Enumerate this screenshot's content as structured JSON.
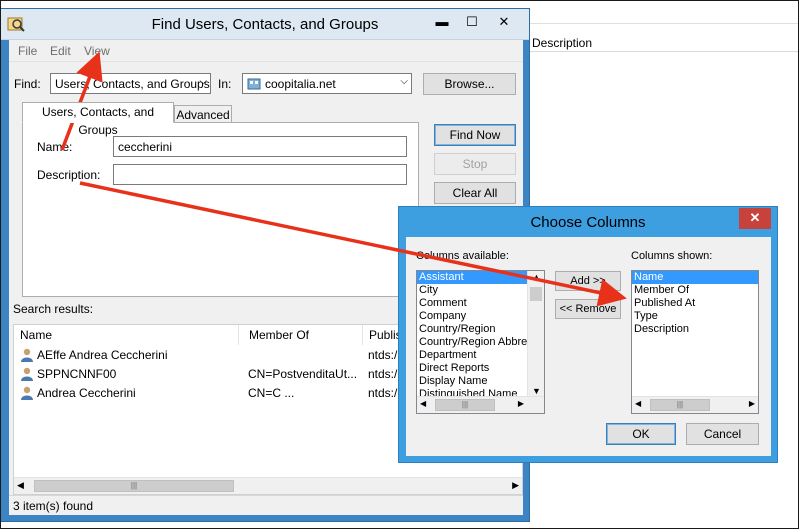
{
  "background": {
    "column_header": "Description"
  },
  "find_window": {
    "title": "Find Users, Contacts, and Groups",
    "minimize": "▬",
    "maximize": "☐",
    "close": "✕",
    "menu": [
      "File",
      "Edit",
      "View"
    ],
    "find_label": "Find:",
    "find_value": "Users, Contacts, and Groups",
    "in_label": "In:",
    "in_value": "coopitalia.net",
    "browse_button": "Browse...",
    "tabs": [
      "Users, Contacts, and Groups",
      "Advanced"
    ],
    "name_label": "Name:",
    "name_value": "ceccherini",
    "description_label": "Description:",
    "description_value": "",
    "find_now_button": "Find Now",
    "stop_button": "Stop",
    "clear_all_button": "Clear All",
    "search_results_label": "Search results:",
    "columns": [
      "Name",
      "Member Of",
      "Publis"
    ],
    "rows": [
      {
        "name": "AEffe Andrea Ceccherini",
        "member_of": "",
        "published": "ntds:/"
      },
      {
        "name": "SPPNCNNF00",
        "member_of": "CN=PostvenditaUt...",
        "published": "ntds:/"
      },
      {
        "name": "Andrea Ceccherini",
        "member_of": "CN=C          ...",
        "published": "ntds:/"
      }
    ],
    "status": "3 item(s) found"
  },
  "choose_columns": {
    "title": "Choose Columns",
    "close": "✕",
    "available_label": "Columns available:",
    "available": [
      "Assistant",
      "City",
      "Comment",
      "Company",
      "Country/Region",
      "Country/Region Abbre",
      "Department",
      "Direct Reports",
      "Display Name",
      "Distinguished Name"
    ],
    "add_button": "Add >>",
    "remove_button": "<< Remove",
    "shown_label": "Columns shown:",
    "shown": [
      "Name",
      "Member Of",
      "Published At",
      "Type",
      "Description"
    ],
    "ok_button": "OK",
    "cancel_button": "Cancel"
  },
  "colors": {
    "annotation_arrow": "#e8311b",
    "window_border": "#3d84c4",
    "dialog_border": "#3d9ee0",
    "selection": "#3399ff"
  }
}
